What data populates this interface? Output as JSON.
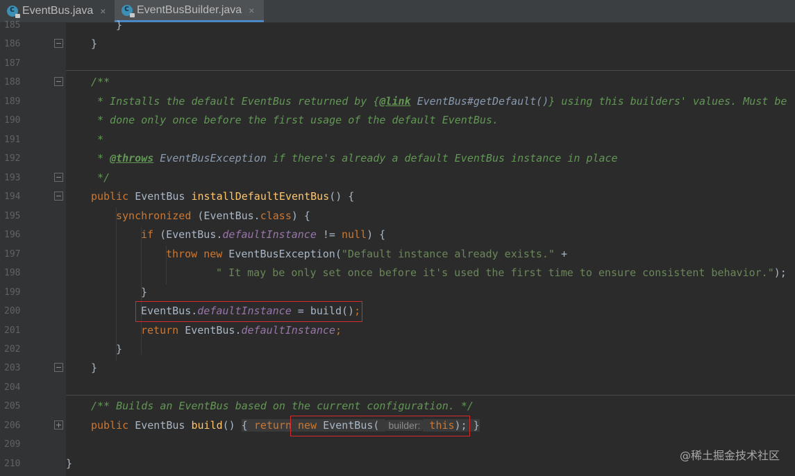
{
  "tabs": [
    {
      "label": "EventBus.java",
      "close": "×"
    },
    {
      "label": "EventBusBuilder.java",
      "close": "×"
    }
  ],
  "lines": {
    "l185": {
      "num": "185",
      "c1": "}"
    },
    "l186": {
      "num": "186",
      "c1": "}"
    },
    "l187": {
      "num": "187"
    },
    "l188": {
      "num": "188",
      "c1": "/**"
    },
    "l189": {
      "num": "189",
      "c1": "* Installs the default EventBus returned by {",
      "c2": "@link",
      "c3": " EventBus#getDefault()",
      "c4": "} using this builders' values. Must be"
    },
    "l190": {
      "num": "190",
      "c1": "* done only once before the first usage of the default EventBus."
    },
    "l191": {
      "num": "191",
      "c1": "*"
    },
    "l192": {
      "num": "192",
      "c1": "* ",
      "c2": "@throws",
      "c3": " EventBusException",
      "c4": " if there's already a default EventBus instance in place"
    },
    "l193": {
      "num": "193",
      "c1": "*/"
    },
    "l194": {
      "num": "194",
      "c1": "public",
      "c2": " EventBus ",
      "c3": "installDefaultEventBus",
      "c4": "() {"
    },
    "l195": {
      "num": "195",
      "c1": "synchronized",
      "c2": " (EventBus.",
      "c3": "class",
      "c4": ") {"
    },
    "l196": {
      "num": "196",
      "c1": "if",
      "c2": " (EventBus.",
      "c3": "defaultInstance",
      "c4": " != ",
      "c5": "null",
      "c6": ") {"
    },
    "l197": {
      "num": "197",
      "c1": "throw",
      "c2": " ",
      "c3": "new",
      "c4": " EventBusException(",
      "c5": "\"Default instance already exists.\"",
      "c6": " +"
    },
    "l198": {
      "num": "198",
      "c1": "\" It may be only set once before it's used the first time to ensure consistent behavior.\"",
      "c2": ");"
    },
    "l199": {
      "num": "199",
      "c1": "}"
    },
    "l200": {
      "num": "200",
      "c1": "EventBus.",
      "c2": "defaultInstance",
      "c3": " = build()",
      "c4": ";"
    },
    "l201": {
      "num": "201",
      "c1": "return",
      "c2": " EventBus.",
      "c3": "defaultInstance",
      "c4": ";"
    },
    "l202": {
      "num": "202",
      "c1": "}"
    },
    "l203": {
      "num": "203",
      "c1": "}"
    },
    "l204": {
      "num": "204"
    },
    "l205": {
      "num": "205",
      "c1": "/** Builds an EventBus based on the current configuration. */"
    },
    "l206": {
      "num": "206",
      "c1": "public",
      "c2": " EventBus ",
      "c3": "build",
      "c4": "() ",
      "c5": "{ ",
      "c6": "return ",
      "c7": "new",
      "c8": " EventBus(",
      "c9": "builder:",
      "c10": "this",
      "c11": ");",
      "c12": " }"
    },
    "l209": {
      "num": "209"
    },
    "l210": {
      "num": "210",
      "c1": "}"
    }
  },
  "watermark": "@稀土掘金技术社区",
  "colors": {
    "background": "#2b2b2b",
    "keyword": "#cc7832",
    "doc_comment": "#629755",
    "field": "#9876aa",
    "method": "#ffc66d",
    "string": "#6a8759",
    "highlight_box": "#d82a2a"
  }
}
